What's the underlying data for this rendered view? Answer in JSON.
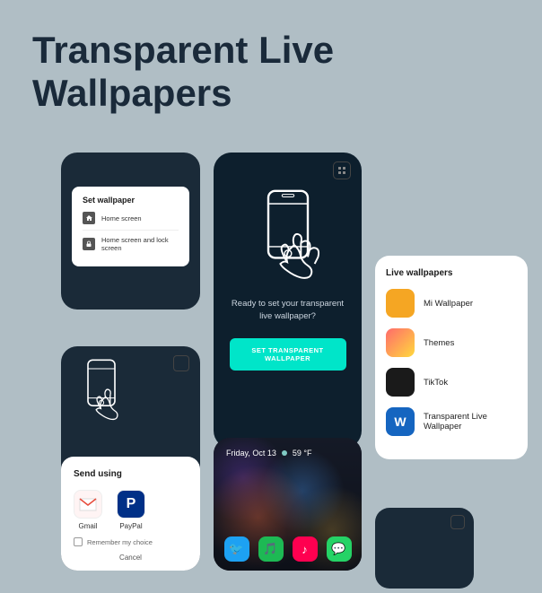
{
  "title": "Transparent Live\nWallpapers",
  "card_dialog": {
    "title": "Set wallpaper",
    "option1": "Home screen",
    "option2": "Home screen and lock screen"
  },
  "card_center": {
    "corner_icon": "⊡",
    "description": "Ready to set your transparent live wallpaper?",
    "button_label": "SET TRANSPARENT WALLPAPER"
  },
  "card_right": {
    "title": "Live wallpapers",
    "items": [
      {
        "name": "Mi Wallpaper",
        "color": "#f5a623"
      },
      {
        "name": "Themes",
        "color_start": "#ff6b6b",
        "color_end": "#ffd93d"
      },
      {
        "name": "TikTok",
        "color": "#1a1a1a"
      },
      {
        "name": "Transparent Live Wallpaper",
        "color": "#1565c0"
      }
    ]
  },
  "card_send": {
    "title": "Send using",
    "options": [
      {
        "label": "Gmail",
        "icon": "✉"
      },
      {
        "label": "PayPal",
        "icon": "P"
      }
    ],
    "remember": "Remember my choice",
    "cancel": "Cancel"
  },
  "card_photo": {
    "date": "Friday, Oct 13",
    "temp": "59 °F"
  }
}
